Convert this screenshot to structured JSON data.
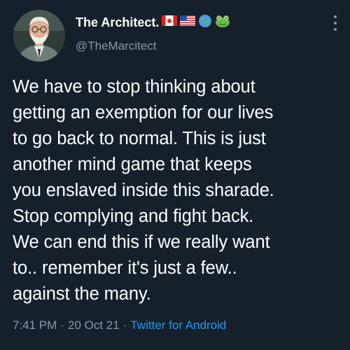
{
  "author": {
    "display_name": "The Architect.",
    "handle": "@TheMarcitect",
    "name_emojis": [
      "canada-flag-icon",
      "usa-flag-icon",
      "globe-icon",
      "frog-icon"
    ]
  },
  "tweet": {
    "text": "We have to stop thinking about\ngetting an exemption for our lives\nto go back to normal. This is just\nanother mind game that keeps\nyou enslaved inside this sharade.\nStop complying and fight back.\nWe can end this if we really want\nto.. remember it's just a few..\nagainst the many."
  },
  "meta": {
    "time": "7:41 PM",
    "separator": "·",
    "date": "20 Oct 21",
    "source": "Twitter for Android"
  },
  "colors": {
    "background": "#15202b",
    "text": "#ffffff",
    "secondary": "#8b98a5",
    "link": "#1d9bf0"
  }
}
